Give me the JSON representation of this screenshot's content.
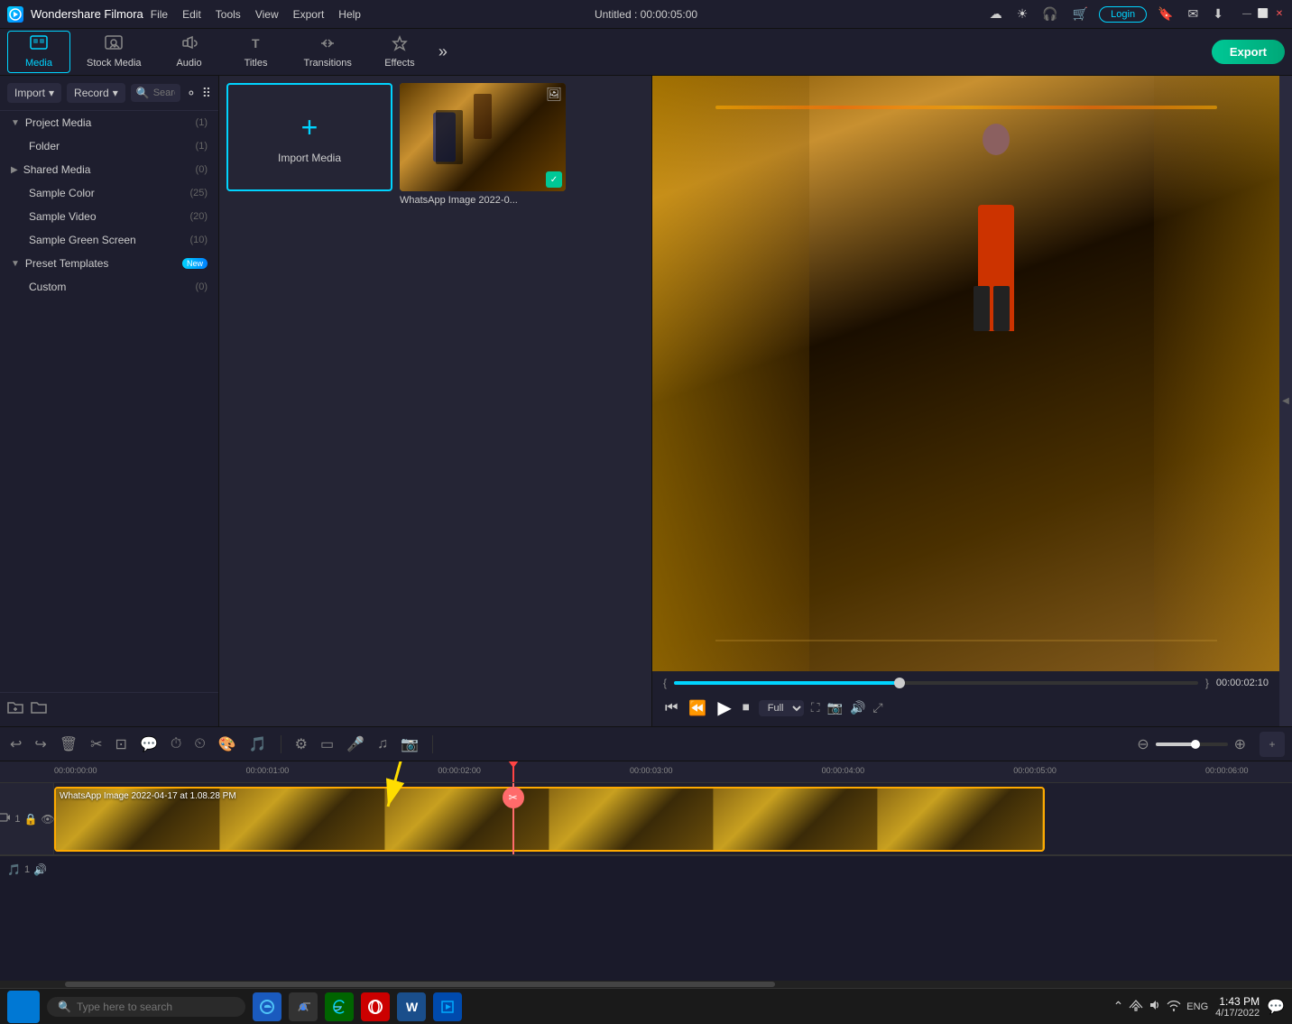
{
  "app": {
    "name": "Wondershare Filmora",
    "logo_letter": "F"
  },
  "titlebar": {
    "menu": [
      "File",
      "Edit",
      "Tools",
      "View",
      "Export",
      "Help"
    ],
    "title": "Untitled : 00:00:05:00",
    "login_label": "Login",
    "icons": [
      "☀",
      "🎧",
      "🛒",
      "🔔",
      "📧",
      "⬇"
    ],
    "win_controls": [
      "—",
      "⬜",
      "✕"
    ]
  },
  "toolbar": {
    "items": [
      {
        "id": "media",
        "label": "Media",
        "icon": "▦",
        "active": true
      },
      {
        "id": "stock-media",
        "label": "Stock Media",
        "icon": "▣"
      },
      {
        "id": "audio",
        "label": "Audio",
        "icon": "♫"
      },
      {
        "id": "titles",
        "label": "Titles",
        "icon": "T"
      },
      {
        "id": "transitions",
        "label": "Transitions",
        "icon": "⇄"
      },
      {
        "id": "effects",
        "label": "Effects",
        "icon": "✦"
      }
    ],
    "export_label": "Export"
  },
  "left_panel": {
    "import_label": "Import",
    "record_label": "Record",
    "search_placeholder": "Search media",
    "tree": [
      {
        "label": "Project Media",
        "count": "(1)",
        "expanded": true,
        "level": 0
      },
      {
        "label": "Folder",
        "count": "(1)",
        "level": 1
      },
      {
        "label": "Shared Media",
        "count": "(0)",
        "expanded": false,
        "level": 0
      },
      {
        "label": "Sample Color",
        "count": "(25)",
        "level": 1
      },
      {
        "label": "Sample Video",
        "count": "(20)",
        "level": 1
      },
      {
        "label": "Sample Green Screen",
        "count": "(10)",
        "level": 1
      },
      {
        "label": "Preset Templates",
        "count": "",
        "level": 0,
        "badge": "New"
      },
      {
        "label": "Custom",
        "count": "(0)",
        "level": 1
      }
    ]
  },
  "media_grid": {
    "import_label": "Import Media",
    "items": [
      {
        "label": "WhatsApp Image 2022-0...",
        "has_check": true
      }
    ]
  },
  "preview": {
    "time_current": "00:00:02:10",
    "progress_pct": 43,
    "quality": "Full",
    "brackets": [
      "{ }",
      "{ }"
    ]
  },
  "timeline": {
    "time_markers": [
      {
        "label": "00:00:00:00",
        "pos": 0
      },
      {
        "label": "00:00:01:00",
        "pos": 16
      },
      {
        "label": "00:00:02:00",
        "pos": 32
      },
      {
        "label": "00:00:03:00",
        "pos": 48
      },
      {
        "label": "00:00:04:00",
        "pos": 64
      },
      {
        "label": "00:00:05:00",
        "pos": 80
      },
      {
        "label": "00:00:06:00",
        "pos": 96
      }
    ],
    "clip_label": "WhatsApp Image 2022-04-17 at 1.08.28 PM",
    "playhead_pos_pct": 37,
    "track_label": "1",
    "audio_track_label": "1"
  },
  "taskbar": {
    "search_placeholder": "Type here to search",
    "apps": [
      "🌐",
      "🔵",
      "⬡",
      "🔴",
      "W",
      "◆"
    ],
    "time": "1:43 PM",
    "date": "4/17/2022",
    "sys_icons": [
      "⬆",
      "📶",
      "🔊",
      "ENG"
    ]
  }
}
